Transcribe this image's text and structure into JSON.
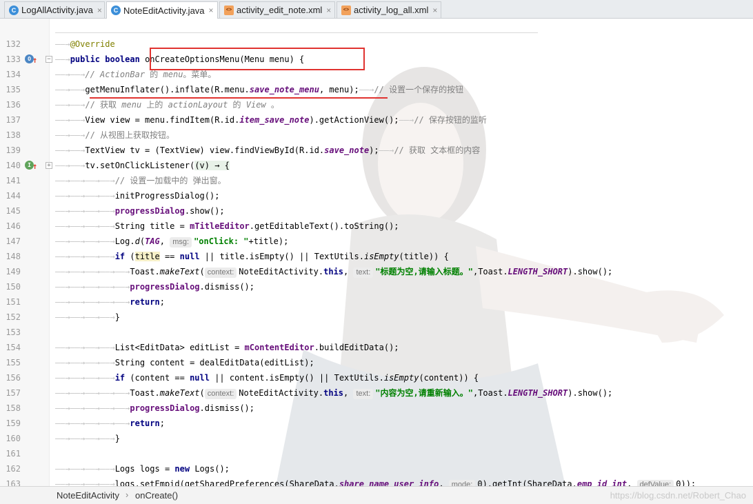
{
  "tabs": [
    {
      "label": "LogAllActivity.java",
      "icon": "java-class-icon",
      "active": false
    },
    {
      "label": "NoteEditActivity.java",
      "icon": "java-class-icon",
      "active": true
    },
    {
      "label": "activity_edit_note.xml",
      "icon": "xml-file-icon",
      "active": false
    },
    {
      "label": "activity_log_all.xml",
      "icon": "xml-file-icon",
      "active": false
    }
  ],
  "close_glyph": "×",
  "line_numbers": [
    "132",
    "133",
    "134",
    "135",
    "136",
    "137",
    "138",
    "139",
    "140",
    "141",
    "144",
    "145",
    "146",
    "147",
    "148",
    "149",
    "150",
    "151",
    "152",
    "153",
    "154",
    "155",
    "156",
    "157",
    "158",
    "159",
    "160",
    "161",
    "162",
    "163",
    "164"
  ],
  "code": {
    "l133": "@Override",
    "l134a": "public boolean",
    "l134b": "onCreateOptionsMenu(Menu menu) {",
    "l135a": "// ActionBar",
    "l135b": " 的 ",
    "l135c": "menu",
    "l135d": "。菜单。",
    "l136a": "getMenuInflater().inflate(R.menu.",
    "l136b": "save_note_menu",
    "l136c": ", menu);",
    "l136d": "// 设置一个保存的按钮",
    "l137a": "// 获取 ",
    "l137b": "menu",
    "l137c": " 上的 ",
    "l137d": "actionLayout",
    "l137e": " 的 ",
    "l137f": "View",
    "l137g": " 。",
    "l138a": "View view = menu.findItem(R.id.",
    "l138b": "item_save_note",
    "l138c": ").getActionView();",
    "l138d": "// 保存按钮的监听",
    "l139": "// 从视图上获取按钮。",
    "l140a": "TextView tv = (TextView) view.findViewById(R.id.",
    "l140b": "save_note",
    "l140c": ");",
    "l140d": "// 获取 文本框的内容",
    "l141a": "tv.setOnClickListener(",
    "l141b": "(v) → {",
    "l144": "// 设置一加载中的 弹出窗。",
    "l145": "initProgressDialog();",
    "l146a": "progressDialog",
    "l146b": ".show();",
    "l147a": "String title = ",
    "l147b": "mTitleEditor",
    "l147c": ".getEditableText().toString();",
    "l148a": "Log.",
    "l148b": "d",
    "l148c": "(",
    "l148d": "TAG",
    "l148e": ", ",
    "l148f": "msg:",
    "l148g": "\"onClick: \"",
    "l148h": "+title);",
    "l149a": "if",
    "l149b": "title",
    "l149c": " == ",
    "l149d": "null",
    "l149e": " || title.isEmpty() || TextUtils.",
    "l149f": "isEmpty",
    "l149g": "(title)) {",
    "l150a": "Toast.",
    "l150b": "makeText",
    "l150c": "context:",
    "l150d": "NoteEditActivity.",
    "l150e": "this",
    "l150f": "text:",
    "l150g": "\"标题为空,请输入标题。\"",
    "l150h": ",Toast.",
    "l150i": "LENGTH_SHORT",
    "l150j": ").show();",
    "l151a": "progressDialog",
    "l151b": ".dismiss();",
    "l152": "return",
    "l153": "}",
    "l155a": "List<EditData> editList = ",
    "l155b": "mContentEditor",
    "l155c": ".buildEditData();",
    "l156": "String content = dealEditData(editList);",
    "l157a": "if",
    "l157b": " (content == ",
    "l157c": "null",
    "l157d": " || content.isEmpty() || TextUtils.",
    "l157e": "isEmpty",
    "l157f": "(content)) {",
    "l158g": "\"内容为空,请重新输入。\"",
    "l163a": "Logs logs = ",
    "l163b": "new",
    "l163c": " Logs();",
    "l164a": "logs.setEmpid(getSharedPreferences(ShareData.",
    "l164b": "share_name_user_info",
    "l164c": "mode:",
    "l164d": "0",
    "l164e": ").getInt(ShareData.",
    "l164f": "emp_id_int",
    "l164g": "defValue:",
    "l164h": "0",
    "l164i": "));"
  },
  "breadcrumb": {
    "class_name": "NoteEditActivity",
    "separator": "›",
    "method": "onCreate()"
  },
  "watermark": "https://blog.csdn.net/Robert_Chao",
  "colors": {
    "annotation_box": "#e0322f",
    "keyword": "#000080",
    "string": "#008000",
    "field": "#660e7a"
  }
}
